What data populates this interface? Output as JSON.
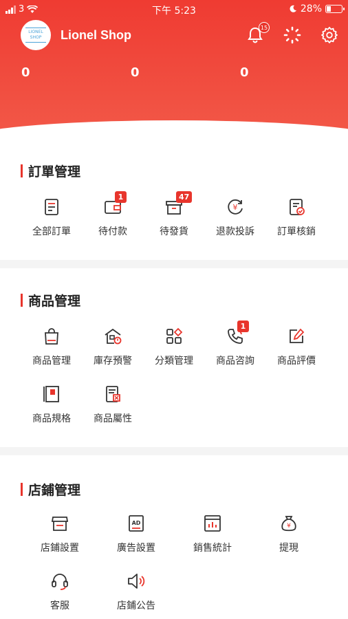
{
  "status_bar": {
    "carrier": "3",
    "time": "下午 5:23",
    "battery": "28%"
  },
  "header": {
    "logo_text": "LIONEL SHOP",
    "shop_name": "Lionel Shop",
    "notification_count": "15",
    "stats": [
      "0",
      "0",
      "0"
    ],
    "accent_color": "#ef3b32"
  },
  "orders": {
    "title": "訂單管理",
    "items": [
      {
        "label": "全部訂單",
        "icon": "order-list-icon",
        "badge": ""
      },
      {
        "label": "待付款",
        "icon": "wallet-icon",
        "badge": "1"
      },
      {
        "label": "待發貨",
        "icon": "box-icon",
        "badge": "47"
      },
      {
        "label": "退款投訴",
        "icon": "refund-icon",
        "badge": ""
      },
      {
        "label": "訂單核銷",
        "icon": "verify-icon",
        "badge": ""
      }
    ]
  },
  "products": {
    "title": "商品管理",
    "items": [
      {
        "label": "商品管理",
        "icon": "shopping-bag-icon",
        "badge": ""
      },
      {
        "label": "庫存預警",
        "icon": "inventory-alert-icon",
        "badge": ""
      },
      {
        "label": "分類管理",
        "icon": "category-icon",
        "badge": ""
      },
      {
        "label": "商品咨詢",
        "icon": "phone-icon",
        "badge": "1"
      },
      {
        "label": "商品評價",
        "icon": "edit-review-icon",
        "badge": ""
      },
      {
        "label": "商品規格",
        "icon": "spec-book-icon",
        "badge": ""
      },
      {
        "label": "商品屬性",
        "icon": "attribute-icon",
        "badge": ""
      }
    ]
  },
  "store": {
    "title": "店鋪管理",
    "items": [
      {
        "label": "店鋪設置",
        "icon": "storefront-icon"
      },
      {
        "label": "廣告設置",
        "icon": "ad-icon"
      },
      {
        "label": "銷售統計",
        "icon": "sales-chart-icon"
      },
      {
        "label": "提現",
        "icon": "money-bag-icon"
      },
      {
        "label": "客服",
        "icon": "headset-icon"
      },
      {
        "label": "店鋪公告",
        "icon": "speaker-icon"
      }
    ]
  }
}
